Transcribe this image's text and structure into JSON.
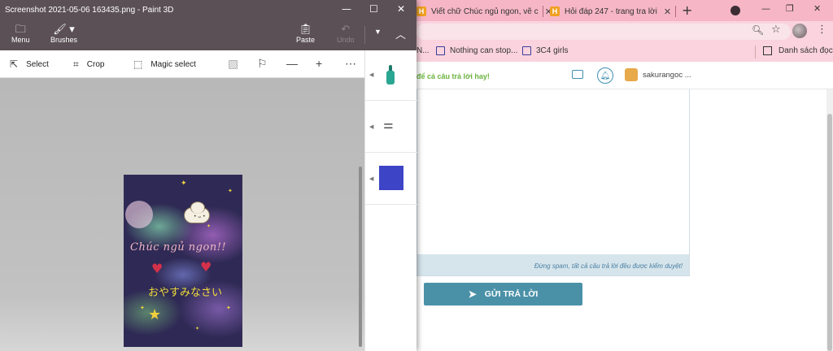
{
  "paint3d": {
    "title": "Screenshot 2021-05-06 163435.png - Paint 3D",
    "ribbon": {
      "menu": "Menu",
      "brushes": "Brushes",
      "paste": "Paste",
      "undo": "Undo"
    },
    "toolbar": {
      "select": "Select",
      "crop": "Crop",
      "magic_select": "Magic select"
    },
    "artwork": {
      "text_vi": "Chúc ngủ ngon!!",
      "text_jp": "おやすみなさい"
    },
    "side_panel": {
      "color": "#3d44c6"
    }
  },
  "chrome": {
    "tabs": [
      {
        "title": "Viết chữ Chúc ngủ ngon, vẽ c",
        "favicon": "H",
        "favicon_color": "#f0a020"
      },
      {
        "title": "Hỏi đáp 247 - trang tra lời",
        "favicon": "H",
        "favicon_color": "#f0a020"
      }
    ],
    "bookmarks": [
      {
        "label": "N..."
      },
      {
        "label": "Nothing can stop..."
      },
      {
        "label": "3C4 girls"
      }
    ],
    "reading_list": "Danh sách đọc",
    "accent": "#f6b6c6"
  },
  "webpage": {
    "hint": "để cả câu trả lời hay!",
    "username": "sakurangoc ...",
    "spam_note": "Đừng spam, tất cả câu trả lời đều được kiểm duyệt!",
    "submit_label": "GỬI TRẢ LỜI"
  }
}
